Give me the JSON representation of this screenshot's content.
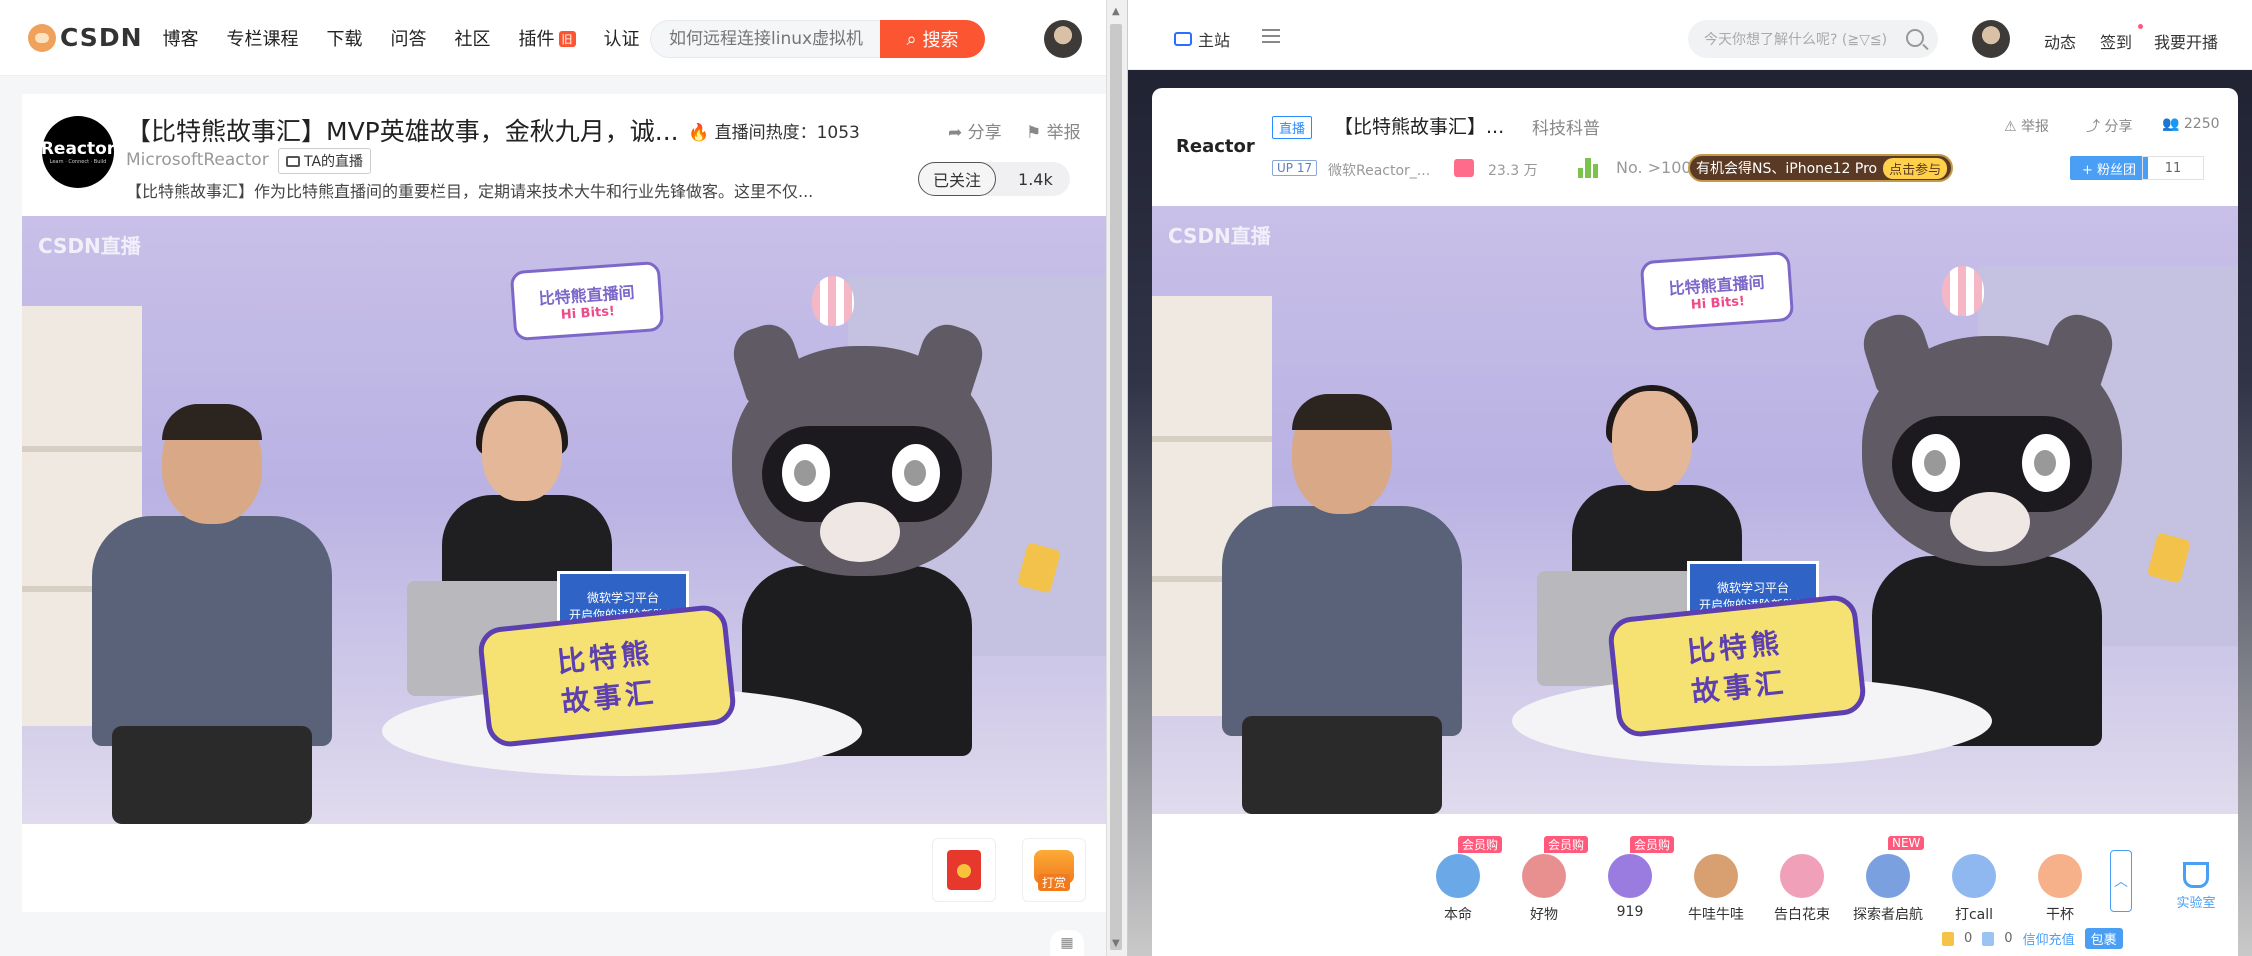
{
  "left": {
    "nav": {
      "logo_text": "CSDN",
      "items": [
        "博客",
        "专栏课程",
        "下载",
        "问答",
        "社区",
        "插件",
        "认证"
      ],
      "plugin_badge": "旧",
      "search_placeholder": "如何远程连接linux虚拟机",
      "search_button": "搜索"
    },
    "room": {
      "logo_top": "Reactor",
      "logo_sub": "Learn · Connect · Build",
      "title": "【比特熊故事汇】MVP英雄故事，金秋九月，诚...",
      "heat_label": "直播间热度：1053",
      "share": "分享",
      "report": "举报",
      "owner": "MicrosoftReactor",
      "ta_live": "TA的直播",
      "desc": "【比特熊故事汇】作为比特熊直播间的重要栏目，定期请来技术大牛和行业先锋做客。这里不仅...",
      "follow": "已关注",
      "follow_count": "1.4k"
    },
    "video": {
      "watermark": "CSDN直播",
      "sign_top": "比特熊直播间",
      "sign_bottom": "Hi Bits!",
      "board_line1": "微软学习平台",
      "board_line2": "开启你的进阶新路径",
      "big_sign_1": "比特熊",
      "big_sign_2": "故事汇"
    },
    "bottom": {
      "tip_label": "打赏"
    }
  },
  "right": {
    "nav": {
      "home": "主站",
      "search_placeholder": "今天你想了解什么呢? (≧▽≦)",
      "dynamic": "动态",
      "signin": "签到",
      "golive": "我要开播"
    },
    "room": {
      "logo": "Reactor",
      "live_tag": "直播",
      "title": "【比特熊故事汇】...",
      "category": "科技科普",
      "report": "举报",
      "share": "分享",
      "people": "2250",
      "up_level": "UP 17",
      "owner": "微软Reactor_...",
      "gift_value": "23.3 万",
      "rank": "No. >100",
      "promo_text": "有机会得NS、iPhone12 Pro",
      "promo_button": "点击参与",
      "fans_button": "+ 粉丝团",
      "fans_count": "11"
    },
    "video": {
      "watermark": "CSDN直播",
      "sign_top": "比特熊直播间",
      "sign_bottom": "Hi Bits!",
      "board_line1": "微软学习平台",
      "board_line2": "开启你的进阶新路径",
      "big_sign_1": "比特熊",
      "big_sign_2": "故事汇"
    },
    "gifts": [
      {
        "name": "本命",
        "badge": "会员购",
        "color": "#6aa8e8"
      },
      {
        "name": "好物",
        "badge": "会员购",
        "color": "#e89090"
      },
      {
        "name": "919",
        "badge": "会员购",
        "color": "#9a7ce0"
      },
      {
        "name": "牛哇牛哇",
        "badge": "",
        "color": "#d8a070"
      },
      {
        "name": "告白花束",
        "badge": "",
        "color": "#f0a0b8"
      },
      {
        "name": "探索者启航",
        "badge": "NEW",
        "color": "#7aa0e0"
      },
      {
        "name": "打call",
        "badge": "",
        "color": "#8fb8f0"
      },
      {
        "name": "干杯",
        "badge": "",
        "color": "#f6b08a"
      }
    ],
    "lab": "实验室",
    "wallet": {
      "gold": "0",
      "silver": "0",
      "recharge": "信仰充值",
      "pack": "包裹"
    }
  },
  "colors": {
    "csdn_accent": "#fc5531",
    "bili_blue": "#4a9ff5",
    "bili_pink": "#ff5a7b"
  }
}
